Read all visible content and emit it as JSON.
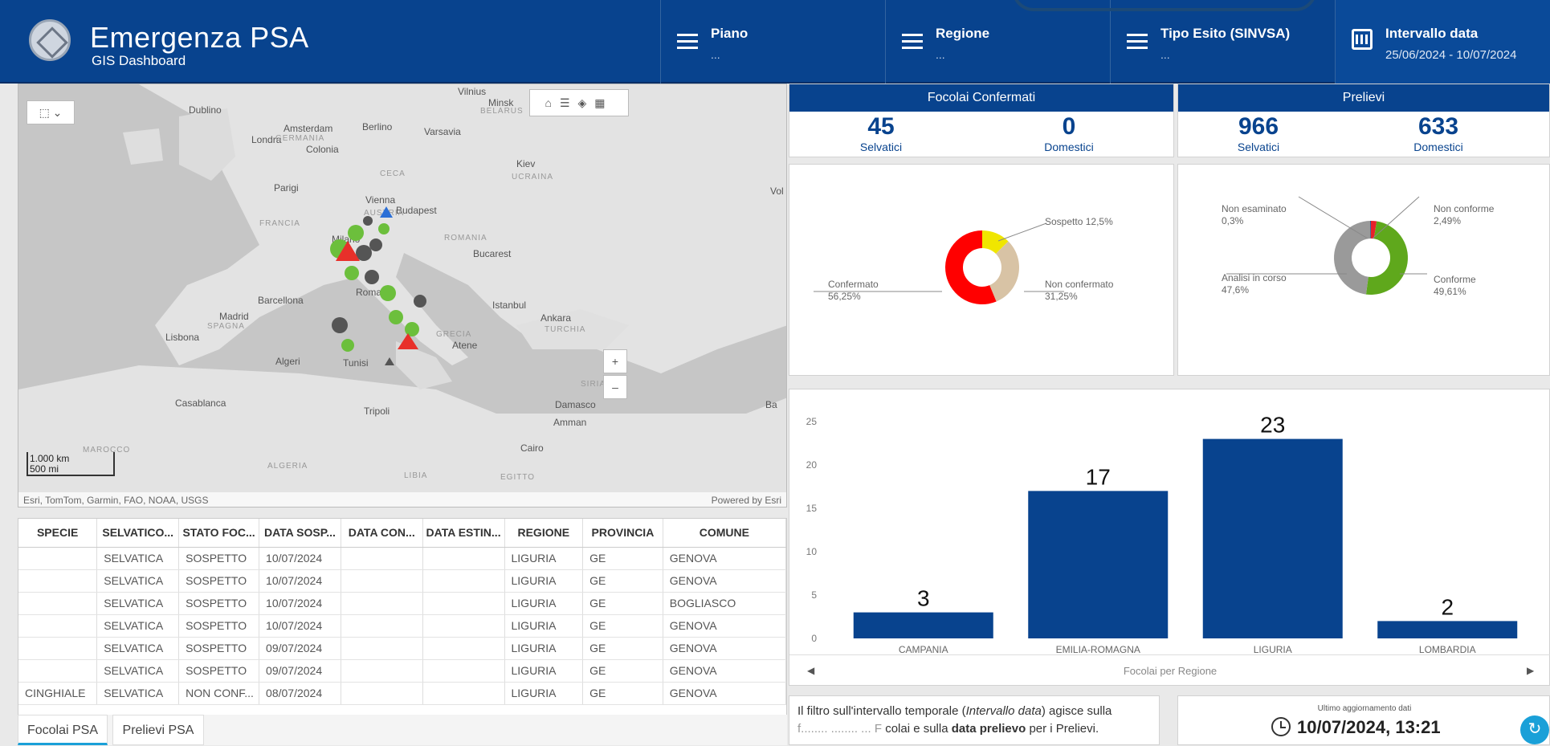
{
  "header": {
    "title": "Emergenza PSA",
    "subtitle": "GIS Dashboard"
  },
  "filters": [
    {
      "label": "Piano",
      "value": "..."
    },
    {
      "label": "Regione",
      "value": "..."
    },
    {
      "label": "Tipo Esito (SINVSA)",
      "value": "..."
    },
    {
      "label": "Intervallo data",
      "value": "25/06/2024 - 10/07/2024"
    }
  ],
  "map": {
    "attribution": "Esri, TomTom, Garmin, FAO, NOAA, USGS",
    "powered": "Powered by Esri",
    "scale_km": "1.000 km",
    "scale_mi": "500 mi",
    "zoom_in": "+",
    "zoom_out": "–",
    "cities": [
      "Dublino",
      "Londra",
      "Amsterdam",
      "Berlino",
      "Varsavia",
      "Vilnius",
      "Minsk",
      "Colonia",
      "Parigi",
      "Vienna",
      "Budapest",
      "Kiev",
      "Milano",
      "Bucarest",
      "Barcellona",
      "Madrid",
      "Roma",
      "Istanbul",
      "Ankara",
      "Lisbona",
      "Algeri",
      "Tunisi",
      "Atene",
      "Casablanca",
      "Tripoli",
      "Damasco",
      "Amman",
      "Cairo",
      "Vol",
      "Ba"
    ],
    "regions": [
      "GERMANIA",
      "FRANCIA",
      "AUSTRIA",
      "ROMANIA",
      "UCRAINA",
      "SPAGNA",
      "TURCHIA",
      "BELARUS",
      "CECA",
      "GRECIA",
      "SIRIA",
      "ALGERIA",
      "LIBIA",
      "EGITTO",
      "MAROCCO"
    ]
  },
  "table": {
    "columns": [
      "SPECIE",
      "SELVATICO...",
      "STATO FOC...",
      "DATA SOSP...",
      "DATA CON...",
      "DATA ESTIN...",
      "REGIONE",
      "PROVINCIA",
      "COMUNE"
    ],
    "rows": [
      [
        "",
        "SELVATICA",
        "SOSPETTO",
        "10/07/2024",
        "",
        "",
        "LIGURIA",
        "GE",
        "GENOVA"
      ],
      [
        "",
        "SELVATICA",
        "SOSPETTO",
        "10/07/2024",
        "",
        "",
        "LIGURIA",
        "GE",
        "GENOVA"
      ],
      [
        "",
        "SELVATICA",
        "SOSPETTO",
        "10/07/2024",
        "",
        "",
        "LIGURIA",
        "GE",
        "BOGLIASCO"
      ],
      [
        "",
        "SELVATICA",
        "SOSPETTO",
        "10/07/2024",
        "",
        "",
        "LIGURIA",
        "GE",
        "GENOVA"
      ],
      [
        "",
        "SELVATICA",
        "SOSPETTO",
        "09/07/2024",
        "",
        "",
        "LIGURIA",
        "GE",
        "GENOVA"
      ],
      [
        "",
        "SELVATICA",
        "SOSPETTO",
        "09/07/2024",
        "",
        "",
        "LIGURIA",
        "GE",
        "GENOVA"
      ],
      [
        "CINGHIALE",
        "SELVATICA",
        "NON CONF...",
        "08/07/2024",
        "",
        "",
        "LIGURIA",
        "GE",
        "GENOVA"
      ]
    ]
  },
  "tabs": [
    "Focolai PSA",
    "Prelievi PSA"
  ],
  "kpi": [
    {
      "title": "Focolai Confermati",
      "items": [
        {
          "value": "45",
          "label": "Selvatici"
        },
        {
          "value": "0",
          "label": "Domestici"
        }
      ]
    },
    {
      "title": "Prelievi",
      "items": [
        {
          "value": "966",
          "label": "Selvatici"
        },
        {
          "value": "633",
          "label": "Domestici"
        }
      ]
    }
  ],
  "pie_focolai": {
    "slices": [
      {
        "label": "Confermato",
        "pct": "56,25%",
        "value": 56.25,
        "color": "#ff0000"
      },
      {
        "label": "Sospetto",
        "pct": "12,5%",
        "value": 12.5,
        "color": "#f0e600"
      },
      {
        "label": "Non confermato",
        "pct": "31,25%",
        "value": 31.25,
        "color": "#d8c3a5"
      }
    ]
  },
  "pie_prelievi": {
    "slices": [
      {
        "label": "Conforme",
        "pct": "49,61%",
        "value": 49.61,
        "color": "#5fa81c"
      },
      {
        "label": "Analisi in corso",
        "pct": "47,6%",
        "value": 47.6,
        "color": "#9a9a9a"
      },
      {
        "label": "Non esaminato",
        "pct": "0,3%",
        "value": 0.3,
        "color": "#08438e"
      },
      {
        "label": "Non conforme",
        "pct": "2,49%",
        "value": 2.49,
        "color": "#e8202a"
      }
    ]
  },
  "chart_data": {
    "type": "bar",
    "categories": [
      "CAMPANIA",
      "EMILIA-ROMAGNA",
      "LIGURIA",
      "LOMBARDIA"
    ],
    "values": [
      3,
      17,
      23,
      2
    ],
    "xlabel": "Focolai per Regione",
    "ylim": [
      0,
      25
    ],
    "yticks": [
      0,
      5,
      10,
      15,
      20,
      25
    ],
    "color": "#08438e",
    "grid": false
  },
  "note": {
    "text_pre": "Il filtro sull'intervallo temporale (",
    "text_em": "Intervallo data",
    "text_mid": ") agisce sulla",
    "line2_pre": "colai e sulla ",
    "line2_bold": "data prelievo",
    "line2_post": " per i Prelievi."
  },
  "update": {
    "label": "Ultimo aggiornamento dati",
    "value": "10/07/2024, 13:21"
  }
}
